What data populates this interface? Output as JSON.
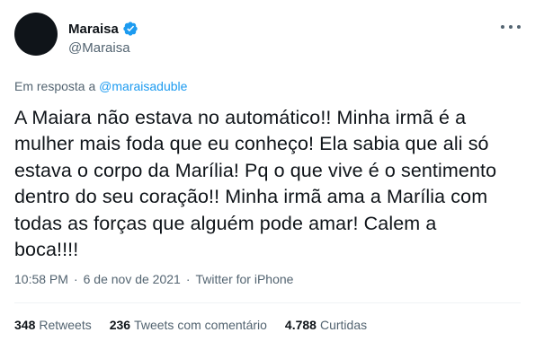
{
  "author": {
    "display_name": "Maraisa",
    "handle": "@Maraisa",
    "verified_icon": "verified-badge-icon",
    "avatar_color": "#0f1419"
  },
  "reply": {
    "prefix": "Em resposta a",
    "mention": "@maraisaduble"
  },
  "tweet": {
    "lines": [
      "A Maiara não estava no automático!! Minha irmã é a",
      "mulher mais foda que eu conheço! Ela sabia que ali só",
      "estava o corpo da Marília! Pq o que vive é o sentimento",
      "dentro do seu coração!! Minha irmã ama a Marília com",
      "todas as forças que alguém pode amar! Calem a",
      "boca!!!!"
    ]
  },
  "meta": {
    "time": "10:58 PM",
    "separator": "·",
    "date": "6 de nov de 2021",
    "source": "Twitter for iPhone"
  },
  "stats": {
    "retweets_count": "348",
    "retweets_label": "Retweets",
    "quotes_count": "236",
    "quotes_label": "Tweets com comentário",
    "likes_count": "4.788",
    "likes_label": "Curtidas"
  },
  "colors": {
    "accent": "#1d9bf0",
    "secondary_text": "#536471",
    "primary_text": "#0f1419"
  }
}
